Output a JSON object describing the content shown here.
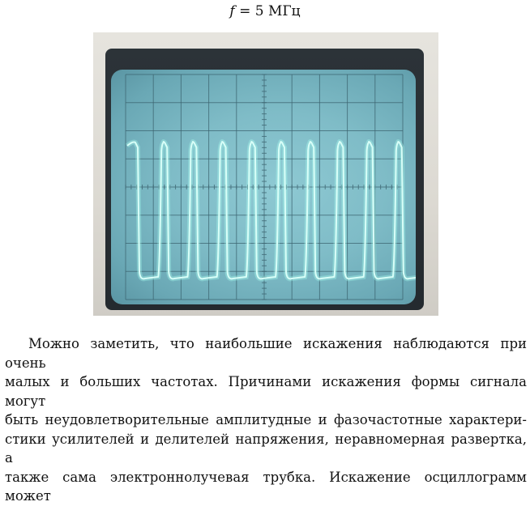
{
  "caption": {
    "variable": "f",
    "equals": " = 5 МГц"
  },
  "paragraph": {
    "lines": [
      "Можно заметить, что наибольшие искажения наблюдаются при очень",
      "малых и больших частотах. Причинами искажения формы сигнала могут",
      "быть неудовлетворительные амплитудные и фазочастотные характери-",
      "стики усилителей и делителей напряжения, неравномерная развертка, а",
      "также сама электроннолучевая трубка. Искажение осциллограмм может"
    ]
  },
  "colors": {
    "screen": "#8ec9d3",
    "trace": "#d8fff8",
    "grid": "#3c6470"
  }
}
